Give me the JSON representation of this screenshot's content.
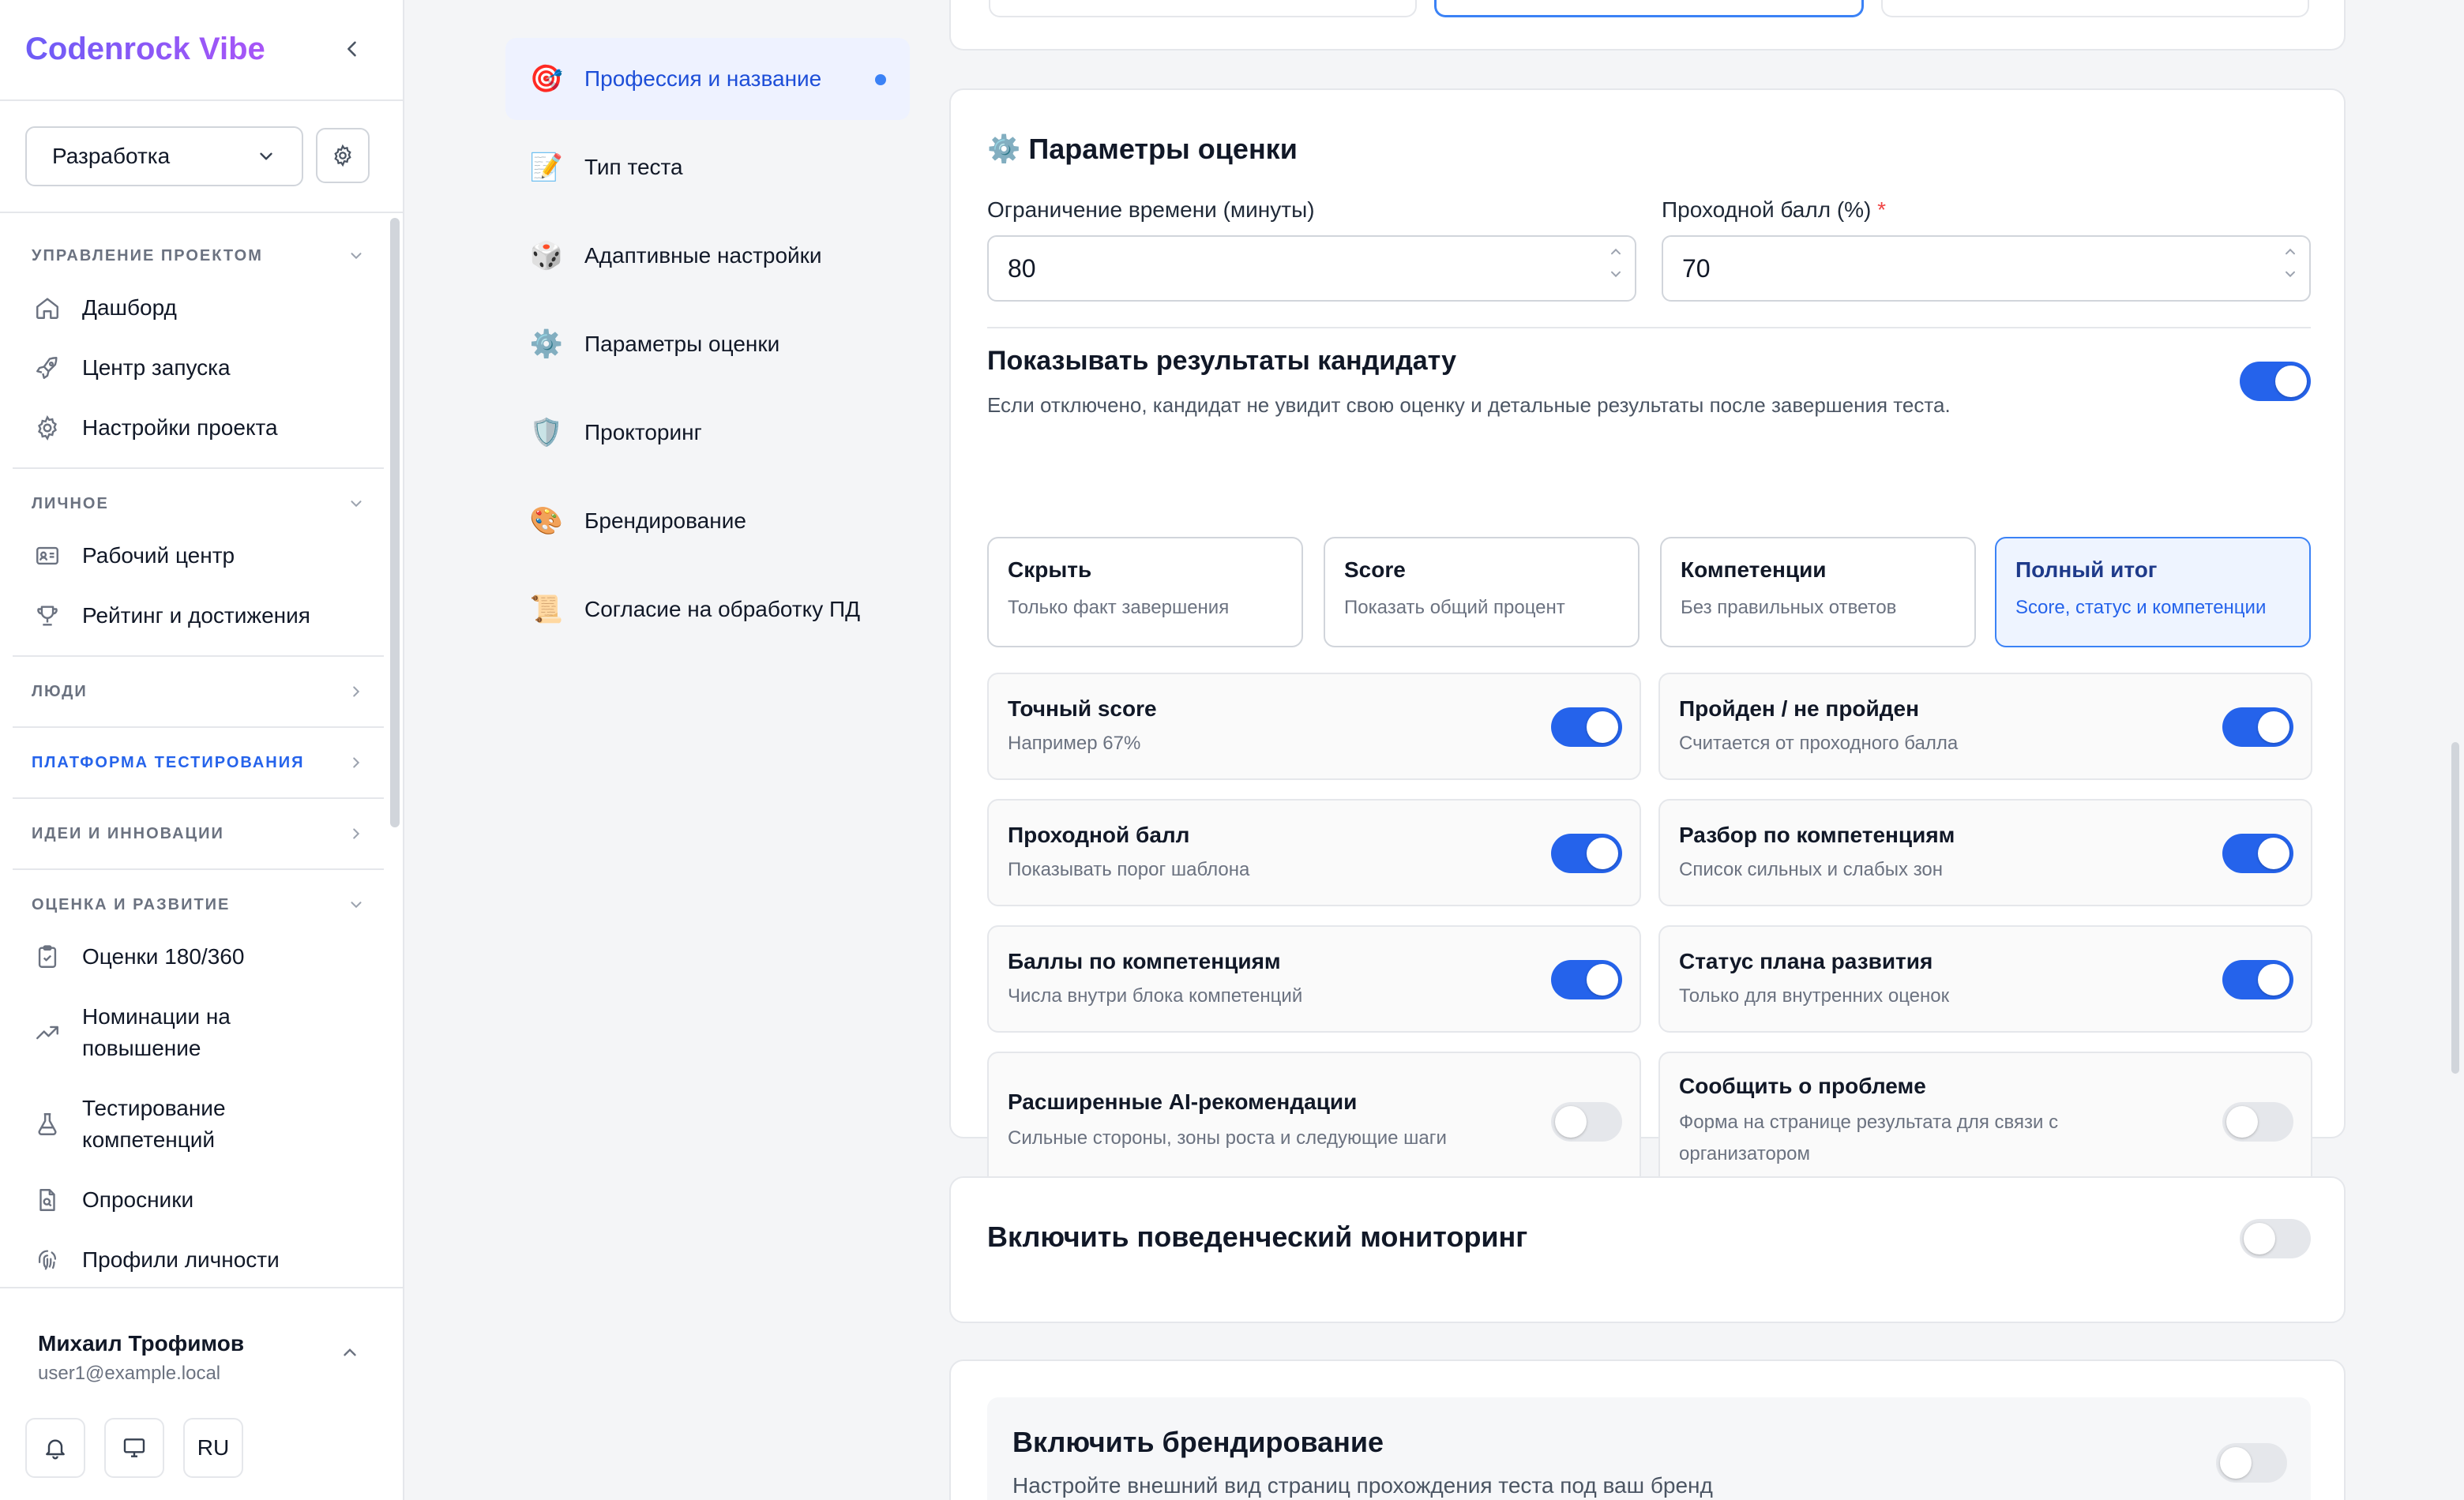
{
  "app": {
    "brand": "Codenrock Vibe"
  },
  "sidebar": {
    "project_select": "Разработка",
    "sections": [
      {
        "title": "УПРАВЛЕНИЕ ПРОЕКТОМ",
        "items": [
          "Дашборд",
          "Центр запуска",
          "Настройки проекта"
        ]
      },
      {
        "title": "ЛИЧНОЕ",
        "items": [
          "Рабочий центр",
          "Рейтинг и достижения"
        ]
      },
      {
        "title": "ЛЮДИ"
      },
      {
        "title": "ПЛАТФОРМА ТЕСТИРОВАНИЯ"
      },
      {
        "title": "ИДЕИ И ИННОВАЦИИ"
      },
      {
        "title": "ОЦЕНКА И РАЗВИТИЕ",
        "items": [
          "Оценки 180/360",
          "Номинации на повышение",
          "Тестирование компетенций",
          "Опросники",
          "Профили личности"
        ]
      }
    ],
    "user": {
      "name": "Михаил Трофимов",
      "email": "user1@example.local"
    },
    "lang": "RU"
  },
  "steps": [
    {
      "label": "Профессия и название",
      "emoji": "🎯"
    },
    {
      "label": "Тип теста",
      "emoji": "📝"
    },
    {
      "label": "Адаптивные настройки",
      "emoji": "🎲"
    },
    {
      "label": "Параметры оценки",
      "emoji": "⚙️"
    },
    {
      "label": "Прокторинг",
      "emoji": "🛡️"
    },
    {
      "label": "Брендирование",
      "emoji": "🎨"
    },
    {
      "label": "Согласие на обработку ПД",
      "emoji": "📜"
    }
  ],
  "assessment": {
    "emoji": "⚙️",
    "title": "Параметры оценки",
    "time_limit_label": "Ограничение времени (минуты)",
    "time_limit_value": "80",
    "pass_score_label": "Проходной балл (%)",
    "pass_score_required": "*",
    "pass_score_value": "70",
    "show_results_title": "Показывать результаты кандидату",
    "show_results_desc": "Если отключено, кандидат не увидит свою оценку и детальные результаты после завершения теста.",
    "show_results_on": true,
    "visibility_options": [
      {
        "title": "Скрыть",
        "subtitle": "Только факт завершения"
      },
      {
        "title": "Score",
        "subtitle": "Показать общий процент"
      },
      {
        "title": "Компетенции",
        "subtitle": "Без правильных ответов"
      },
      {
        "title": "Полный итог",
        "subtitle": "Score, статус и компетенции",
        "selected": true
      }
    ],
    "toggles": [
      {
        "title": "Точный score",
        "subtitle": "Например 67%",
        "on": true
      },
      {
        "title": "Пройден / не пройден",
        "subtitle": "Считается от проходного балла",
        "on": true
      },
      {
        "title": "Проходной балл",
        "subtitle": "Показывать порог шаблона",
        "on": true
      },
      {
        "title": "Разбор по компетенциям",
        "subtitle": "Список сильных и слабых зон",
        "on": true
      },
      {
        "title": "Баллы по компетенциям",
        "subtitle": "Числа внутри блока компетенций",
        "on": true
      },
      {
        "title": "Статус плана развития",
        "subtitle": "Только для внутренних оценок",
        "on": true
      },
      {
        "title": "Расширенные AI-рекомендации",
        "subtitle": "Сильные стороны, зоны роста и следующие шаги",
        "on": false
      },
      {
        "title": "Сообщить о проблеме",
        "subtitle": "Форма на странице результата для связи с организатором",
        "on": false
      }
    ]
  },
  "monitoring": {
    "title": "Включить поведенческий мониторинг",
    "on": false
  },
  "branding": {
    "title": "Включить брендирование",
    "desc": "Настройте внешний вид страниц прохождения теста под ваш бренд",
    "on": false
  }
}
